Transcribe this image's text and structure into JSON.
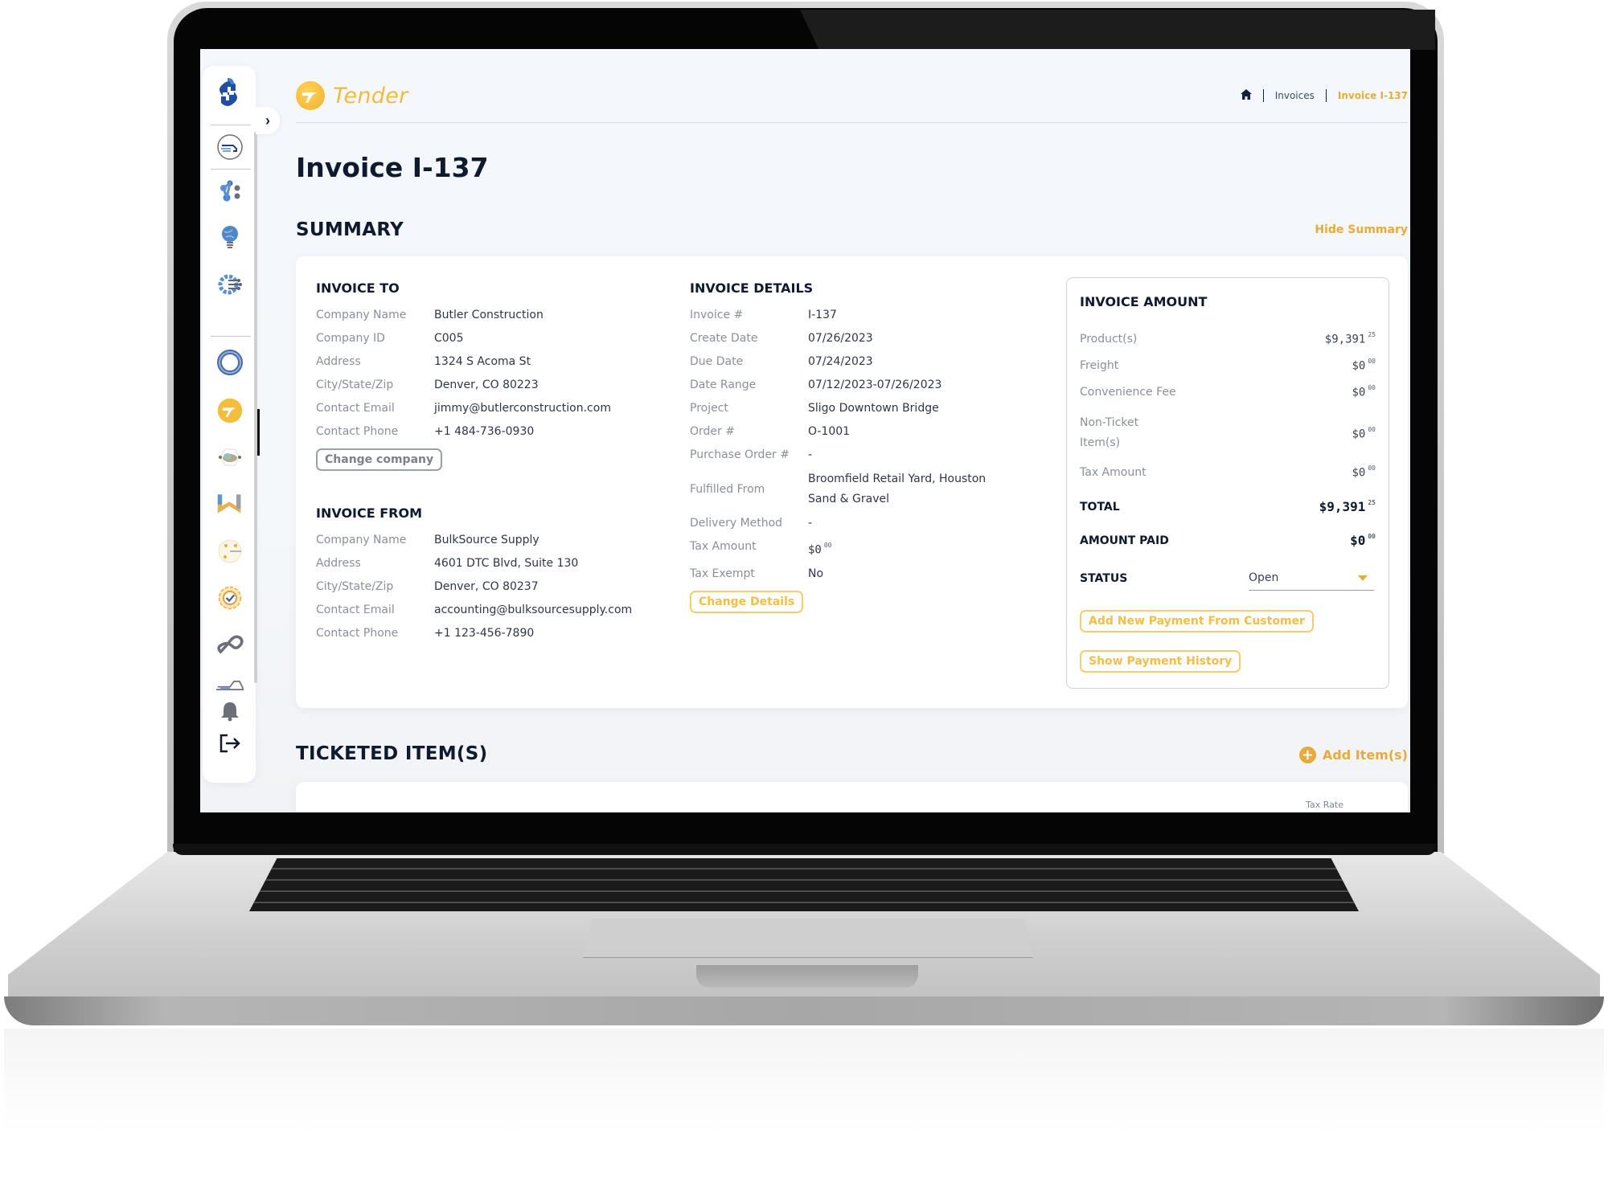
{
  "app": {
    "brand_name": "Tender",
    "accent_color": "#e7ab3a"
  },
  "sidebar": {
    "toggle_icon": "chevron-right-icon",
    "items": [
      {
        "name": "hub-logo",
        "icon": "hub-logo-icon"
      },
      {
        "name": "dispatch",
        "icon": "speed-truck-icon"
      },
      {
        "name": "network",
        "icon": "molecule-network-icon"
      },
      {
        "name": "ideas",
        "icon": "lightbulb-globe-icon"
      },
      {
        "name": "integrations",
        "icon": "gear-circuit-icon"
      },
      {
        "name": "ring-app",
        "icon": "ring-icon"
      },
      {
        "name": "tender",
        "icon": "tender-logo-icon",
        "active": true
      },
      {
        "name": "cloud-network",
        "icon": "cloud-network-icon"
      },
      {
        "name": "w-app",
        "icon": "w-logo-icon"
      },
      {
        "name": "radar",
        "icon": "radar-icon"
      },
      {
        "name": "approval",
        "icon": "gear-check-icon"
      },
      {
        "name": "infinity",
        "icon": "infinity-icon"
      },
      {
        "name": "truck-ramp",
        "icon": "truck-ramp-icon"
      },
      {
        "name": "notifications",
        "icon": "bell-icon"
      },
      {
        "name": "logout",
        "icon": "logout-icon"
      }
    ]
  },
  "breadcrumb": {
    "home_icon": "home-icon",
    "items": [
      "Invoices"
    ],
    "current": "Invoice I-137"
  },
  "page": {
    "title": "Invoice I-137"
  },
  "summary": {
    "title": "SUMMARY",
    "hide_label": "Hide Summary",
    "invoice_to": {
      "title": "INVOICE TO",
      "fields": [
        {
          "label": "Company Name",
          "value": "Butler Construction"
        },
        {
          "label": "Company ID",
          "value": "C005"
        },
        {
          "label": "Address",
          "value": "1324 S Acoma St"
        },
        {
          "label": "City/State/Zip",
          "value": "Denver, CO 80223"
        },
        {
          "label": "Contact Email",
          "value": "jimmy@butlerconstruction.com"
        },
        {
          "label": "Contact Phone",
          "value": "+1 484-736-0930"
        }
      ],
      "button": "Change company"
    },
    "invoice_from": {
      "title": "INVOICE FROM",
      "fields": [
        {
          "label": "Company Name",
          "value": "BulkSource Supply"
        },
        {
          "label": "Address",
          "value": "4601 DTC Blvd, Suite 130"
        },
        {
          "label": "City/State/Zip",
          "value": "Denver, CO 80237"
        },
        {
          "label": "Contact Email",
          "value": "accounting@bulksourcesupply.com"
        },
        {
          "label": "Contact Phone",
          "value": "+1 123-456-7890"
        }
      ]
    },
    "invoice_details": {
      "title": "INVOICE DETAILS",
      "fields": [
        {
          "label": "Invoice #",
          "value": "I-137"
        },
        {
          "label": "Create Date",
          "value": "07/26/2023"
        },
        {
          "label": "Due Date",
          "value": "07/24/2023"
        },
        {
          "label": "Date Range",
          "value": "07/12/2023-07/26/2023"
        },
        {
          "label": "Project",
          "value": "Sligo Downtown Bridge"
        },
        {
          "label": "Order #",
          "value": "O-1001"
        },
        {
          "label": "Purchase Order #",
          "value": "-"
        },
        {
          "label": "Fulfilled From",
          "value": "Broomfield Retail Yard, Houston Sand & Gravel"
        },
        {
          "label": "Delivery Method",
          "value": "-"
        },
        {
          "label": "Tax Amount",
          "value": "$0",
          "cents": "00"
        },
        {
          "label": "Tax Exempt",
          "value": "No"
        }
      ],
      "button": "Change Details"
    },
    "invoice_amount": {
      "title": "INVOICE AMOUNT",
      "rows": [
        {
          "label": "Product(s)",
          "dollars": "$9,391",
          "cents": "25"
        },
        {
          "label": "Freight",
          "dollars": "$0",
          "cents": "00"
        },
        {
          "label": "Convenience Fee",
          "dollars": "$0",
          "cents": "00"
        },
        {
          "label": "Non-Ticket Item(s)",
          "dollars": "$0",
          "cents": "00"
        },
        {
          "label": "Tax Amount",
          "dollars": "$0",
          "cents": "00"
        }
      ],
      "total": {
        "label": "TOTAL",
        "dollars": "$9,391",
        "cents": "25"
      },
      "amount_paid": {
        "label": "AMOUNT PAID",
        "dollars": "$0",
        "cents": "00"
      },
      "status": {
        "label": "STATUS",
        "value": "Open"
      },
      "add_payment_button": "Add New Payment From Customer",
      "payment_history_button": "Show Payment History"
    }
  },
  "ticketed_items": {
    "title": "TICKETED ITEM(S)",
    "add_label": "Add Item(s)",
    "visible_header": "Tax Rate"
  }
}
